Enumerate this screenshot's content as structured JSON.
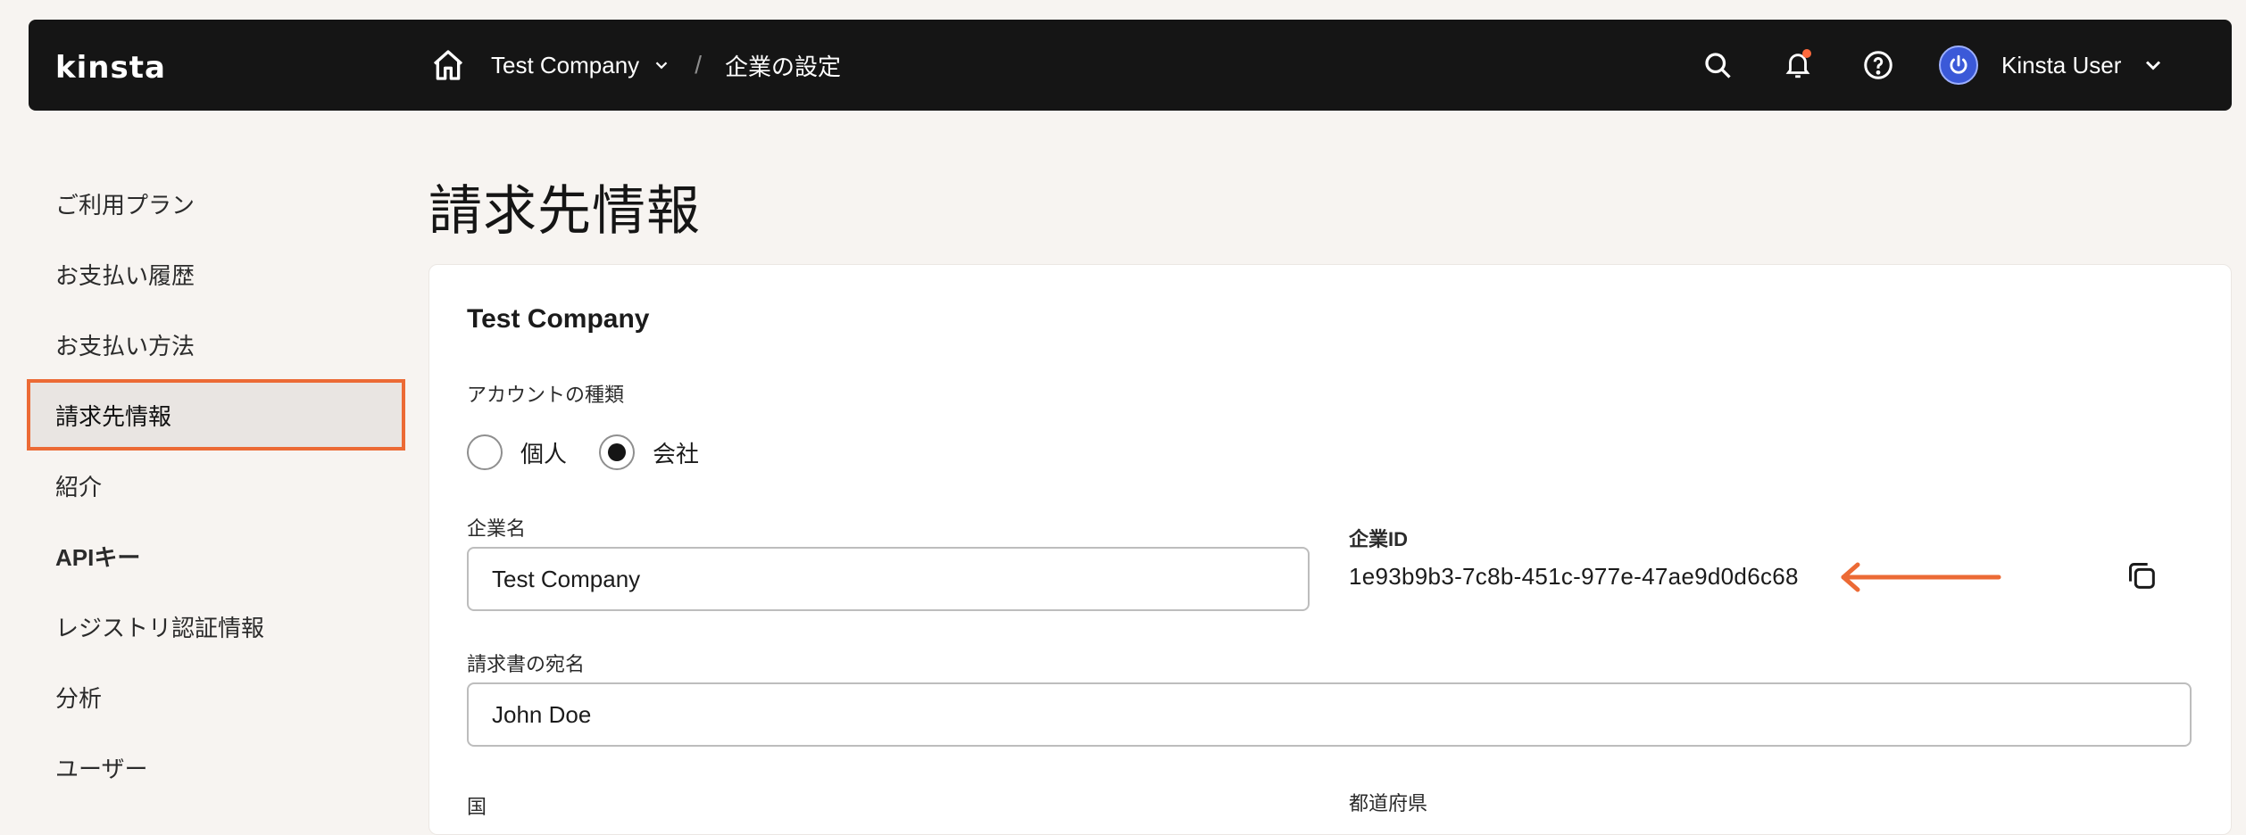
{
  "header": {
    "logo": "kinsta",
    "breadcrumb": {
      "home_icon": "home-icon",
      "company": "Test Company",
      "separator": "/",
      "current": "企業の設定"
    },
    "icons": [
      "search-icon",
      "bell-icon",
      "help-icon"
    ],
    "user_name": "Kinsta User"
  },
  "sidebar": {
    "items": [
      {
        "label": "ご利用プラン",
        "active": false
      },
      {
        "label": "お支払い履歴",
        "active": false
      },
      {
        "label": "お支払い方法",
        "active": false
      },
      {
        "label": "請求先情報",
        "active": true
      },
      {
        "label": "紹介",
        "active": false
      },
      {
        "label": "APIキー",
        "active": false
      },
      {
        "label": "レジストリ認証情報",
        "active": false
      },
      {
        "label": "分析",
        "active": false
      },
      {
        "label": "ユーザー",
        "active": false
      }
    ]
  },
  "main": {
    "page_title": "請求先情報",
    "card": {
      "title": "Test Company",
      "account_type_label": "アカウントの種類",
      "account_types": [
        {
          "label": "個人",
          "selected": false
        },
        {
          "label": "会社",
          "selected": true
        }
      ],
      "company_name_label": "企業名",
      "company_name_value": "Test Company",
      "company_id_label": "企業ID",
      "company_id_value": "1e93b9b3-7c8b-451c-977e-47ae9d0d6c68",
      "invoice_recipient_label": "請求書の宛名",
      "invoice_recipient_value": "John Doe",
      "country_label": "国",
      "prefecture_label": "都道府県"
    }
  },
  "colors": {
    "accent": "#ec6a35",
    "topbar": "#151515",
    "background": "#f7f4f1",
    "avatar": "#3b59d8"
  }
}
